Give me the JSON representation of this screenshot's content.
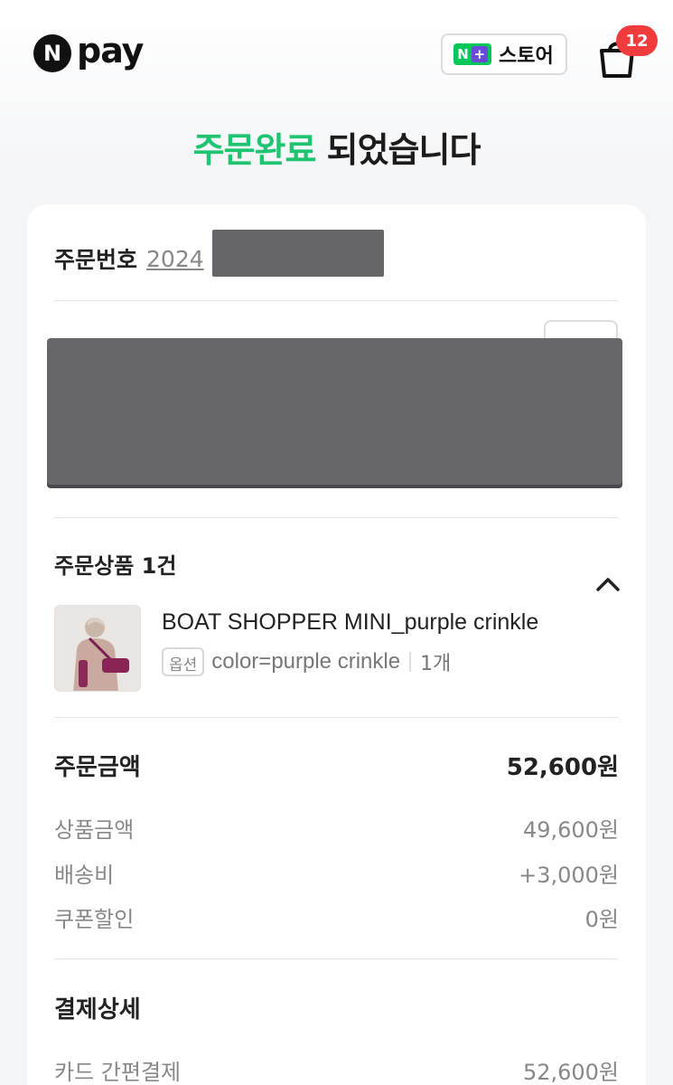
{
  "header": {
    "logo_letter": "N",
    "logo_text": "pay",
    "store_button": {
      "badge_n": "N",
      "badge_plus": "+",
      "label": "스토어"
    },
    "cart_count": "12"
  },
  "headline": {
    "highlight": "주문완료",
    "rest": " 되었습니다"
  },
  "order": {
    "label": "주문번호",
    "number_visible": "2024"
  },
  "products": {
    "title": "주문상품 1건",
    "item": {
      "name": "BOAT SHOPPER MINI_purple crinkle",
      "option_tag": "옵션",
      "option_value": "color=purple crinkle",
      "quantity": "1개"
    }
  },
  "amount": {
    "title": "주문금액",
    "total": "52,600원",
    "lines": [
      {
        "label": "상품금액",
        "value": "49,600원"
      },
      {
        "label": "배송비",
        "value": "+3,000원"
      },
      {
        "label": "쿠폰할인",
        "value": "0원"
      }
    ]
  },
  "payment": {
    "title": "결제상세",
    "method_label": "카드 간편결제",
    "method_value": "52,600원"
  },
  "colors": {
    "brand_green": "#1ec46f",
    "badge_red": "#f03c3c",
    "redaction": "#66666a"
  }
}
